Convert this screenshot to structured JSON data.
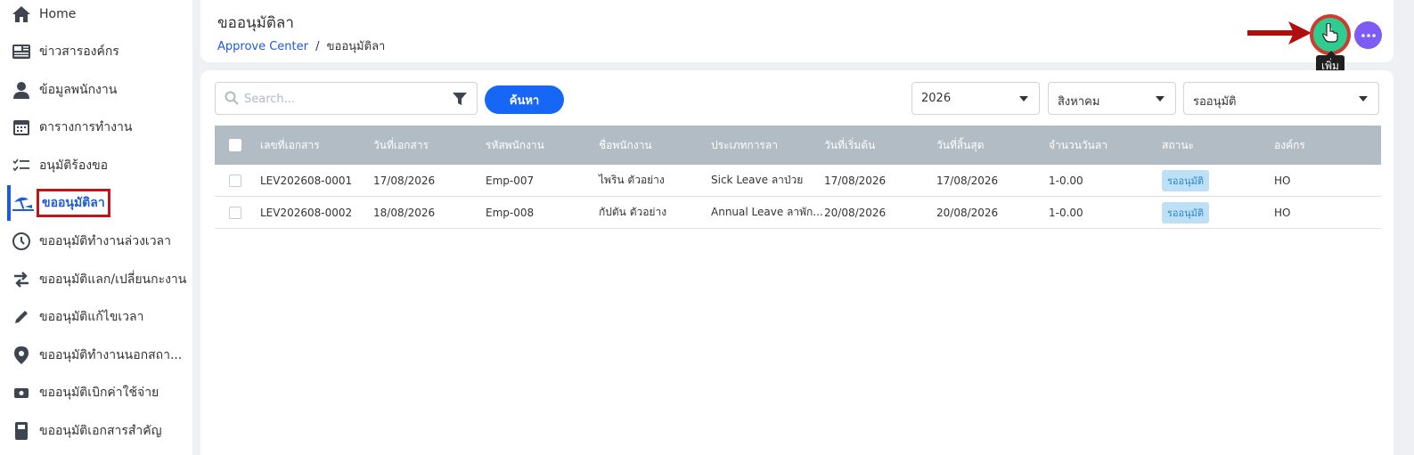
{
  "sidebar": {
    "items": [
      {
        "label": "Home",
        "icon": "home-icon"
      },
      {
        "label": "ข่าวสารองค์กร",
        "icon": "news-icon"
      },
      {
        "label": "ข้อมูลพนักงาน",
        "icon": "user-icon"
      },
      {
        "label": "ตารางการทำงาน",
        "icon": "calendar-icon"
      },
      {
        "label": "อนุมัติร้องขอ",
        "icon": "checklist-icon"
      },
      {
        "label": "ขออนุมัติลา",
        "icon": "beach-umbrella-icon",
        "active": true
      },
      {
        "label": "ขออนุมัติทำงานล่วงเวลา",
        "icon": "clock-history-icon"
      },
      {
        "label": "ขออนุมัติแลก/เปลี่ยนกะงาน",
        "icon": "swap-arrows-icon"
      },
      {
        "label": "ขออนุมัติแก้ไขเวลา",
        "icon": "pencil-icon"
      },
      {
        "label": "ขออนุมัติทำงานนอกสถา...",
        "icon": "location-pin-icon"
      },
      {
        "label": "ขออนุมัติเบิกค่าใช้จ่าย",
        "icon": "money-icon"
      },
      {
        "label": "ขออนุมัติเอกสารสำคัญ",
        "icon": "document-icon"
      }
    ]
  },
  "header": {
    "title": "ขออนุมัติลา",
    "breadcrumb_link": "Approve Center",
    "breadcrumb_sep": "/",
    "breadcrumb_current": "ขออนุมัติลา",
    "add_tooltip": "เพิ่ม"
  },
  "filters": {
    "search_placeholder": "Search...",
    "search_button": "ค้นหา",
    "year": "2026",
    "month": "สิงหาคม",
    "status": "รออนุมัติ"
  },
  "table": {
    "columns": [
      "เลขที่เอกสาร",
      "วันที่เอกสาร",
      "รหัสพนักงาน",
      "ชื่อพนักงาน",
      "ประเภทการลา",
      "วันที่เริ่มต้น",
      "วันที่สิ้นสุด",
      "จำนวนวันลา",
      "สถานะ",
      "องค์กร"
    ],
    "rows": [
      [
        "LEV202608-0001",
        "17/08/2026",
        "Emp-007",
        "ไพริน ตัวอย่าง",
        "Sick Leave ลาป่วย",
        "17/08/2026",
        "17/08/2026",
        "1-0.00",
        "รออนุมัติ",
        "HO"
      ],
      [
        "LEV202608-0002",
        "18/08/2026",
        "Emp-008",
        "กัปตัน ตัวอย่าง",
        "Annual Leave ลาพัก...",
        "20/08/2026",
        "20/08/2026",
        "1-0.00",
        "รออนุมัติ",
        "HO"
      ]
    ]
  },
  "colors": {
    "accent": "#1667f5",
    "add_button": "#2ecc8f",
    "more_button": "#7c5cf5",
    "highlight": "#c0161b",
    "table_header": "#b1bcc4"
  }
}
